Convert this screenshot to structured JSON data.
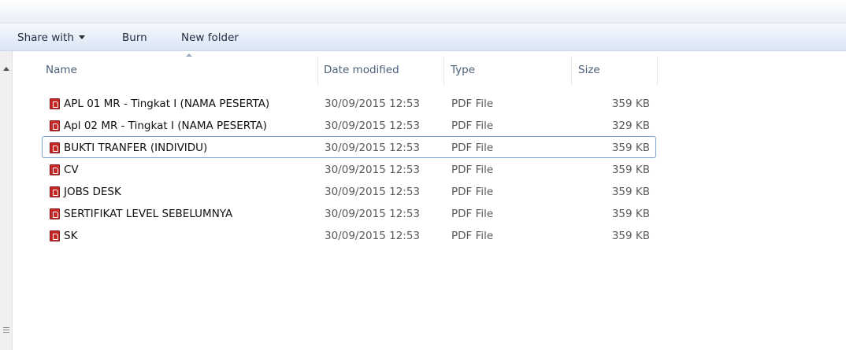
{
  "toolbar": {
    "share_label": "Share with",
    "burn_label": "Burn",
    "new_folder_label": "New folder"
  },
  "columns": {
    "name": "Name",
    "date": "Date modified",
    "type": "Type",
    "size": "Size"
  },
  "files": [
    {
      "name": "APL 01  MR - Tingkat I (NAMA PESERTA)",
      "date": "30/09/2015 12:53",
      "type": "PDF File",
      "size": "359 KB"
    },
    {
      "name": "Apl 02  MR - Tingkat I (NAMA PESERTA)",
      "date": "30/09/2015 12:53",
      "type": "PDF File",
      "size": "329 KB"
    },
    {
      "name": "BUKTI TRANFER (INDIVIDU)",
      "date": "30/09/2015 12:53",
      "type": "PDF File",
      "size": "359 KB"
    },
    {
      "name": "CV",
      "date": "30/09/2015 12:53",
      "type": "PDF File",
      "size": "359 KB"
    },
    {
      "name": "JOBS DESK",
      "date": "30/09/2015 12:53",
      "type": "PDF File",
      "size": "359 KB"
    },
    {
      "name": "SERTIFIKAT LEVEL SEBELUMNYA",
      "date": "30/09/2015 12:53",
      "type": "PDF File",
      "size": "359 KB"
    },
    {
      "name": "SK",
      "date": "30/09/2015 12:53",
      "type": "PDF File",
      "size": "359 KB"
    }
  ],
  "focused_index": 2,
  "icons": {
    "file": "pdf-file-icon",
    "share_caret": "chevron-down-icon",
    "scroll_up": "scroll-up-arrow-icon",
    "sort": "sort-ascending-icon"
  },
  "colors": {
    "pdf_icon": "#c62828",
    "focus_border": "#7da2ce",
    "header_text": "#4c607a"
  }
}
